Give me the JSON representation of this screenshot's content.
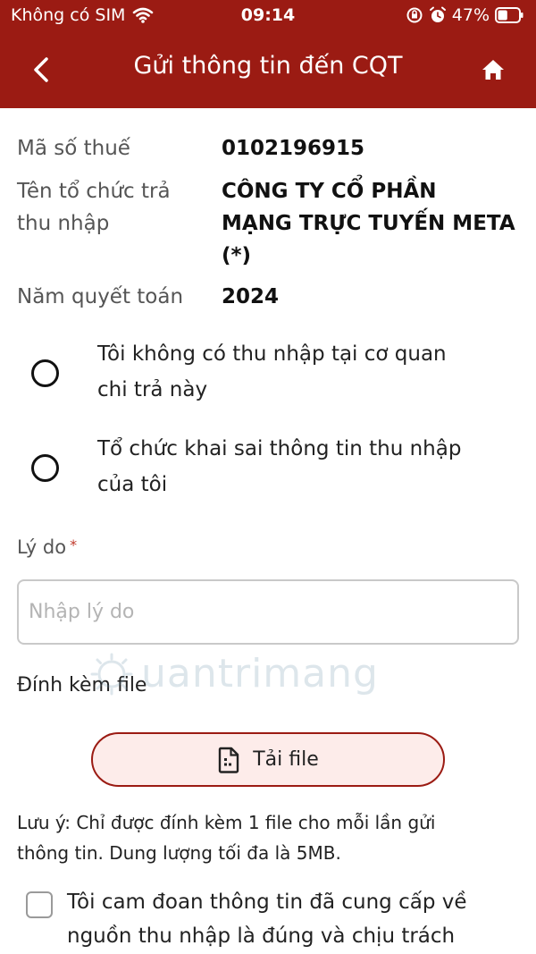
{
  "status_bar": {
    "carrier": "Không có SIM",
    "time": "09:14",
    "battery": "47%",
    "battery_level": 0.47,
    "icons": [
      "wifi-icon",
      "rotation-lock-icon",
      "alarm-icon",
      "battery-icon"
    ]
  },
  "header": {
    "title": "Gửi thông tin đến CQT",
    "back_icon": "chevron-left-icon",
    "home_icon": "home-icon",
    "background": "#9b1b13"
  },
  "info": {
    "tax_code_label": "Mã số thuế",
    "tax_code": "0102196915",
    "org_label_line1": "Tên tổ chức trả",
    "org_label_line2": "thu nhập",
    "org_name_line1": "CÔNG TY CỔ PHẦN",
    "org_name_line2": "MẠNG TRỰC TUYẾN META",
    "org_name_line3": "(*)",
    "year_label": "Năm quyết toán",
    "year": "2024"
  },
  "options": [
    {
      "line1": "Tôi không có thu nhập tại cơ quan",
      "line2": "chi trả này",
      "selected": false
    },
    {
      "line1": "Tổ chức khai sai thông tin thu nhập",
      "line2": "của tôi",
      "selected": false
    }
  ],
  "reason": {
    "label": "Lý do",
    "required_mark": "*",
    "placeholder": "Nhập lý do",
    "value": ""
  },
  "attachment": {
    "label": "Đính kèm file",
    "button_label": "Tải file",
    "button_icon": "file-icon",
    "note_line1": "Lưu ý: Chỉ được đính kèm 1 file cho mỗi lần gửi",
    "note_line2": "thông tin. Dung lượng tối đa là 5MB."
  },
  "commitment": {
    "line1": "Tôi cam đoan thông tin đã cung cấp về",
    "line2": "nguồn thu nhập là đúng và chịu trách",
    "checked": false
  },
  "watermark": {
    "text": "uantrimang"
  },
  "colors": {
    "brand": "#9b1b13",
    "button_fill": "#fdecea",
    "border": "#c9c9c9",
    "required": "#c0392b"
  }
}
